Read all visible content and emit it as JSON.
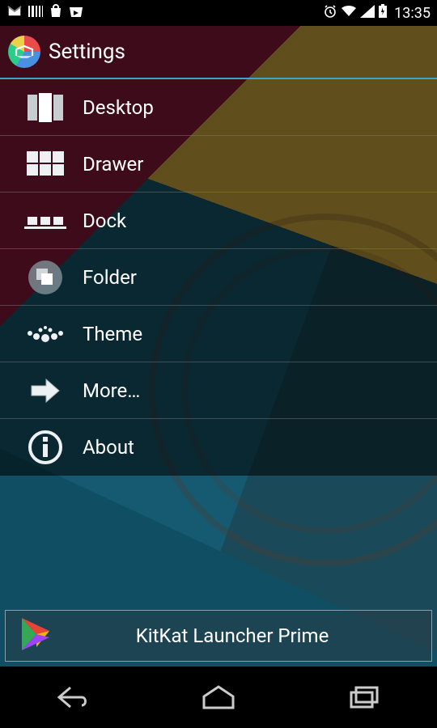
{
  "status": {
    "time": "13:35"
  },
  "header": {
    "title": "Settings"
  },
  "items": [
    {
      "label": "Desktop"
    },
    {
      "label": "Drawer"
    },
    {
      "label": "Dock"
    },
    {
      "label": "Folder"
    },
    {
      "label": "Theme"
    },
    {
      "label": "More…"
    },
    {
      "label": "About"
    }
  ],
  "promo": {
    "label": "KitKat Launcher Prime"
  }
}
